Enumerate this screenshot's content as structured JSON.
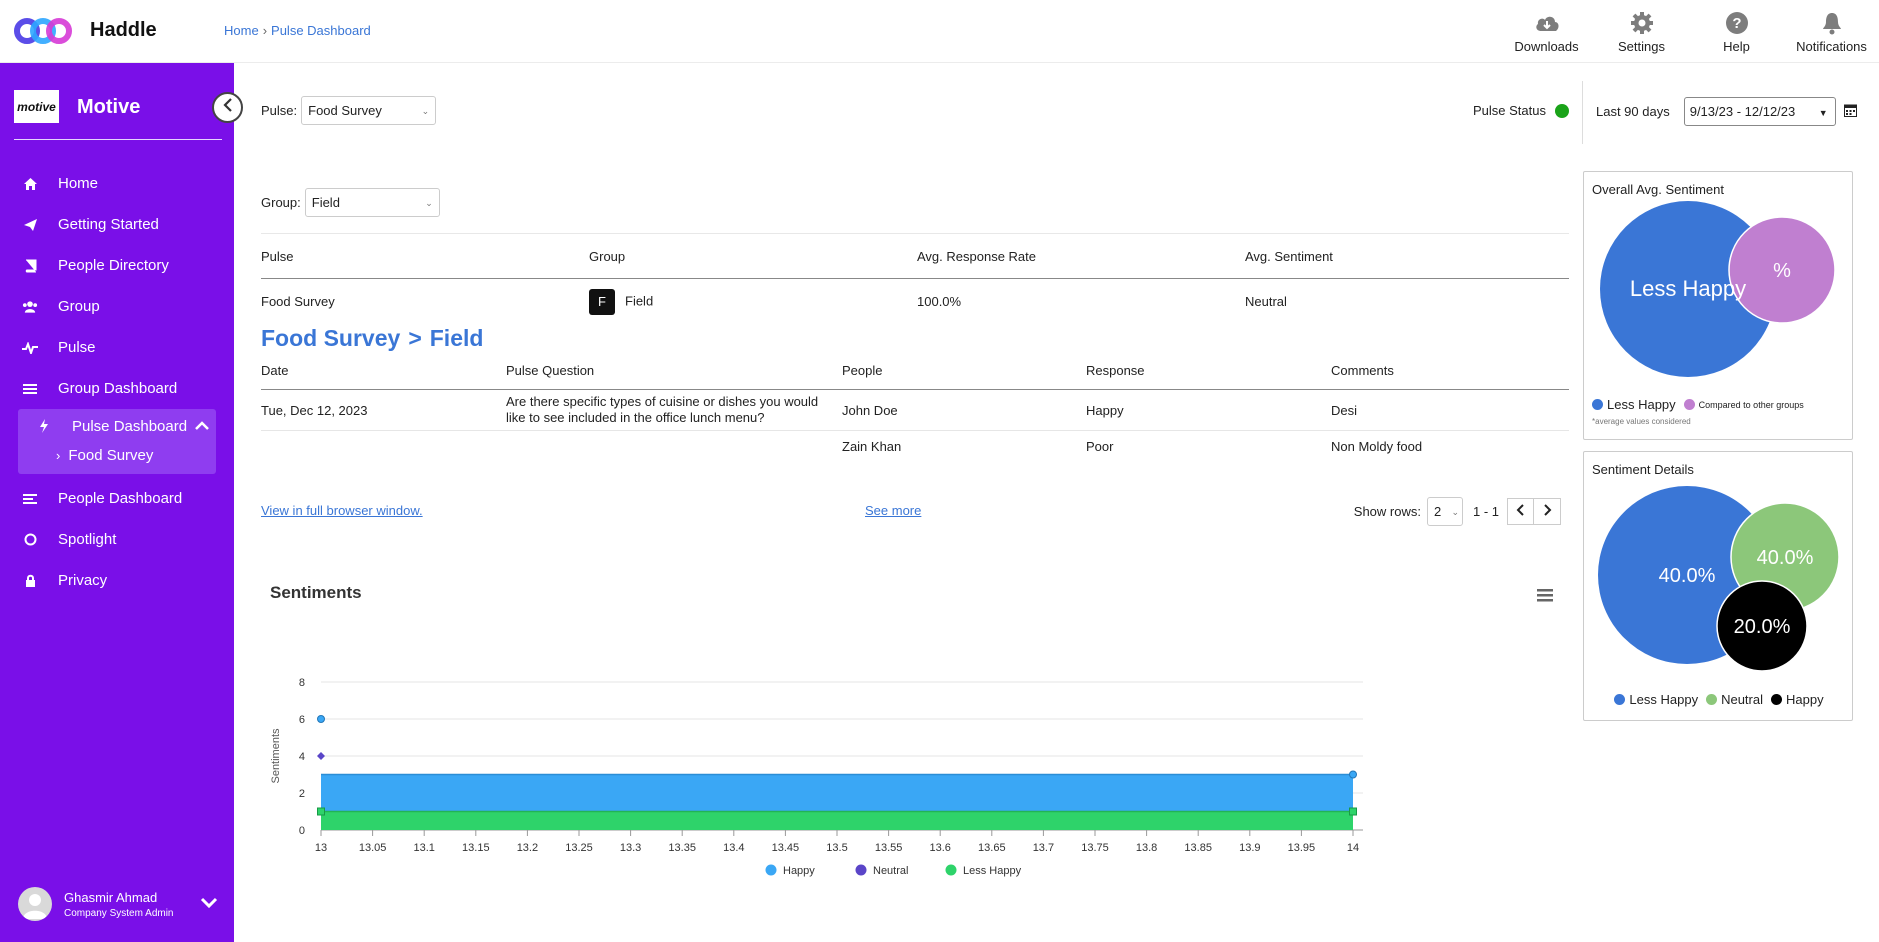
{
  "app": {
    "name": "Haddle"
  },
  "breadcrumb": {
    "home": "Home",
    "current": "Pulse Dashboard"
  },
  "top_actions": [
    {
      "label": "Downloads",
      "icon": "cloud-download-icon"
    },
    {
      "label": "Settings",
      "icon": "gear-icon"
    },
    {
      "label": "Help",
      "icon": "question-icon"
    },
    {
      "label": "Notifications",
      "icon": "bell-icon"
    }
  ],
  "sidebar": {
    "org_logo_text": "motive",
    "org_name": "Motive",
    "items": [
      {
        "label": "Home",
        "icon": "home-icon"
      },
      {
        "label": "Getting Started",
        "icon": "paper-plane-icon"
      },
      {
        "label": "People Directory",
        "icon": "book-icon"
      },
      {
        "label": "Group",
        "icon": "users-icon"
      },
      {
        "label": "Pulse",
        "icon": "pulse-icon"
      },
      {
        "label": "Group Dashboard",
        "icon": "list-icon"
      },
      {
        "label": "Pulse Dashboard",
        "icon": "bolt-icon",
        "expanded": true
      },
      {
        "label": "People Dashboard",
        "icon": "list-lines-icon"
      },
      {
        "label": "Spotlight",
        "icon": "circle-icon"
      },
      {
        "label": "Privacy",
        "icon": "lock-icon"
      }
    ],
    "sub_items": [
      {
        "label": "Food Survey"
      }
    ],
    "user": {
      "name": "Ghasmir Ahmad",
      "role": "Company System Admin"
    }
  },
  "filters": {
    "pulse_label": "Pulse:",
    "pulse_value": "Food Survey",
    "group_label": "Group:",
    "group_value": "Field",
    "pulse_status_label": "Pulse Status",
    "pulse_status_color": "#1aa319",
    "date_label": "Last 90 days",
    "date_value": "9/13/23 - 12/12/23"
  },
  "summary_table": {
    "headers": [
      "Pulse",
      "Group",
      "Avg. Response Rate",
      "Avg. Sentiment"
    ],
    "rows": [
      {
        "pulse": "Food Survey",
        "group_initial": "F",
        "group": "Field",
        "rate": "100.0%",
        "sentiment": "Neutral"
      }
    ]
  },
  "drilldown": {
    "pulse": "Food Survey",
    "separator": ">",
    "group": "Field"
  },
  "detail_table": {
    "headers": [
      "Date",
      "Pulse Question",
      "People",
      "Response",
      "Comments"
    ],
    "rows": [
      {
        "date": "Tue, Dec 12, 2023",
        "question": "Are there specific types of cuisine or dishes you would like to see included in the office lunch menu?",
        "person": "John Doe",
        "response": "Happy",
        "comment": "Desi"
      },
      {
        "date": "",
        "question": "",
        "person": "Zain Khan",
        "response": "Poor",
        "comment": "Non Moldy food"
      }
    ]
  },
  "table_footer": {
    "full_window_link": "View in full browser window.",
    "see_more_link": "See more",
    "show_rows_label": "Show rows:",
    "rows_value": "2",
    "range_text": "1 - 1"
  },
  "chart_data": {
    "type": "area",
    "title": "Sentiments",
    "ylabel": "Sentiments",
    "xlabel": "",
    "ylim": [
      0,
      8
    ],
    "yticks": [
      "0",
      "2",
      "4",
      "6",
      "8"
    ],
    "xlim": [
      13,
      14
    ],
    "xticks": [
      "13",
      "13.05",
      "13.1",
      "13.15",
      "13.2",
      "13.25",
      "13.3",
      "13.35",
      "13.4",
      "13.45",
      "13.5",
      "13.55",
      "13.6",
      "13.65",
      "13.7",
      "13.75",
      "13.8",
      "13.85",
      "13.9",
      "13.95",
      "14"
    ],
    "series": [
      {
        "name": "Happy",
        "color": "#3aa7f5",
        "marker": "circle",
        "points": [
          [
            13,
            6
          ],
          [
            14,
            3
          ]
        ]
      },
      {
        "name": "Neutral",
        "color": "#5a45c8",
        "marker": "diamond",
        "points": [
          [
            13,
            4
          ]
        ]
      },
      {
        "name": "Less Happy",
        "color": "#2ed36a",
        "marker": "square",
        "points": [
          [
            13,
            1
          ],
          [
            14,
            1
          ]
        ]
      }
    ],
    "grid": true,
    "legend": "bottom-center"
  },
  "overall_card": {
    "title": "Overall Avg. Sentiment",
    "main_label": "Less Happy",
    "compare_label": "%",
    "legend": [
      {
        "label": "Less Happy",
        "color": "#3a76d6"
      },
      {
        "label": "Compared to other groups",
        "color": "#c07fd0"
      }
    ],
    "note": "*average values considered"
  },
  "details_card": {
    "title": "Sentiment Details",
    "bubbles": [
      {
        "label": "Less Happy",
        "value": "40.0%",
        "color": "#3a76d6"
      },
      {
        "label": "Neutral",
        "value": "40.0%",
        "color": "#8cc77a"
      },
      {
        "label": "Happy",
        "value": "20.0%",
        "color": "#000000"
      }
    ]
  }
}
